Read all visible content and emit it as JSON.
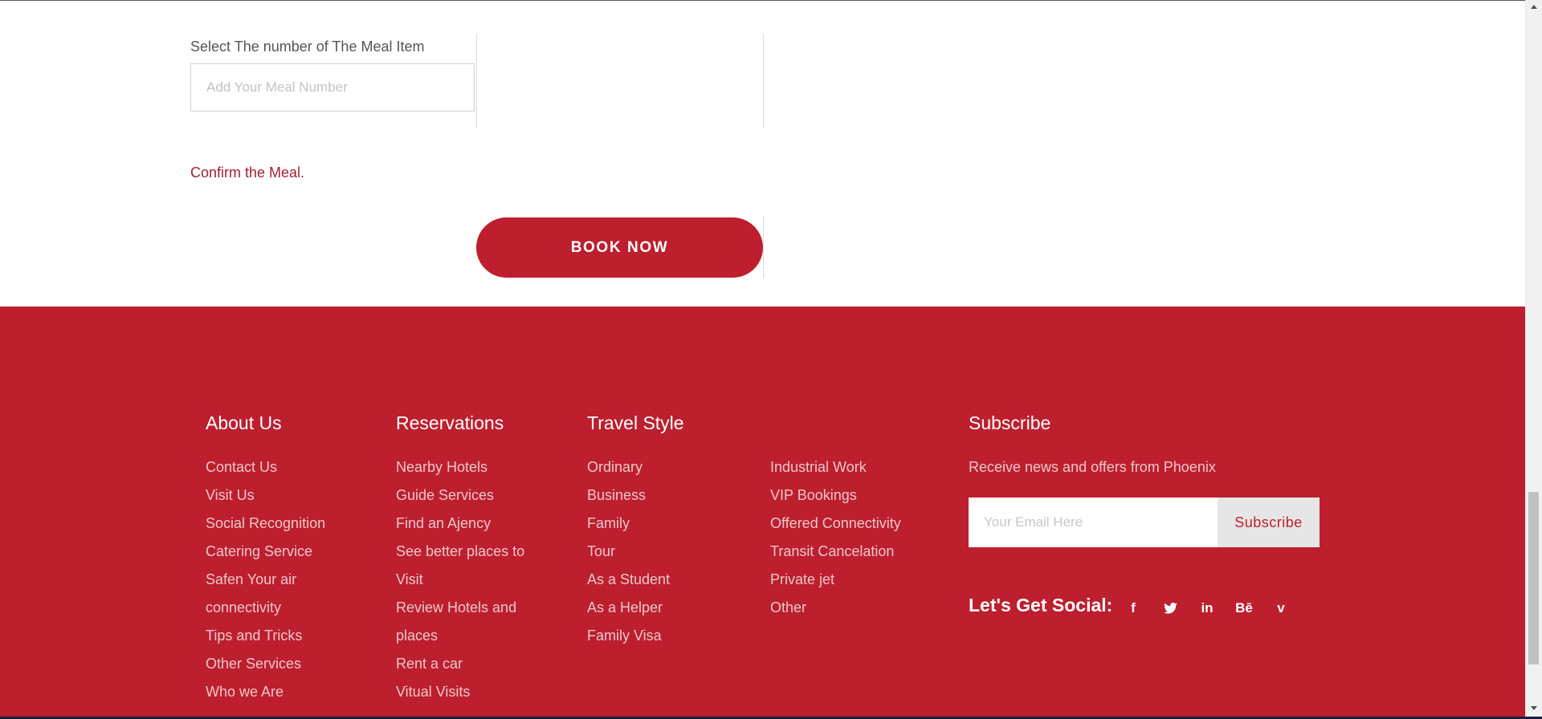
{
  "booking": {
    "meal_label": "Select The number of The Meal Item",
    "meal_placeholder": "Add Your Meal Number",
    "confirm_text": "Confirm the Meal.",
    "book_button": "BOOK NOW"
  },
  "footer": {
    "about": {
      "heading": "About Us",
      "items": [
        "Contact Us",
        "Visit Us",
        "Social Recognition",
        "Catering Service",
        "Safen Your air connectivity",
        "Tips and Tricks",
        "Other Services",
        "Who we Are"
      ]
    },
    "reservations": {
      "heading": "Reservations",
      "items": [
        "Nearby Hotels",
        "Guide Services",
        "Find an Ajency",
        "See better places to Visit",
        "Review Hotels and places",
        "Rent a car",
        "Vitual Visits"
      ]
    },
    "travel_style": {
      "heading": "Travel Style",
      "items_left": [
        "Ordinary",
        "Business",
        "Family",
        "Tour",
        "As a Student",
        "As a Helper",
        "Family Visa"
      ],
      "items_right": [
        "Industrial Work",
        "VIP Bookings",
        "Offered Connectivity",
        "Transit Cancelation",
        "Private jet",
        "Other"
      ]
    },
    "subscribe": {
      "heading": "Subscribe",
      "text": "Receive news and offers from Phoenix",
      "email_placeholder": "Your Email Here",
      "button": "Subscribe"
    },
    "social": {
      "label": "Let's Get Social:",
      "icons": [
        {
          "name": "facebook-icon",
          "glyph": "f"
        },
        {
          "name": "twitter-icon",
          "glyph": "🐦"
        },
        {
          "name": "linkedin-icon",
          "glyph": "in"
        },
        {
          "name": "behance-icon",
          "glyph": "Bē"
        },
        {
          "name": "vimeo-icon",
          "glyph": "v"
        }
      ]
    }
  },
  "colors": {
    "brand_red": "#bd1f2e",
    "link_text": "#ecc6c9",
    "confirm_red": "#a32033"
  }
}
